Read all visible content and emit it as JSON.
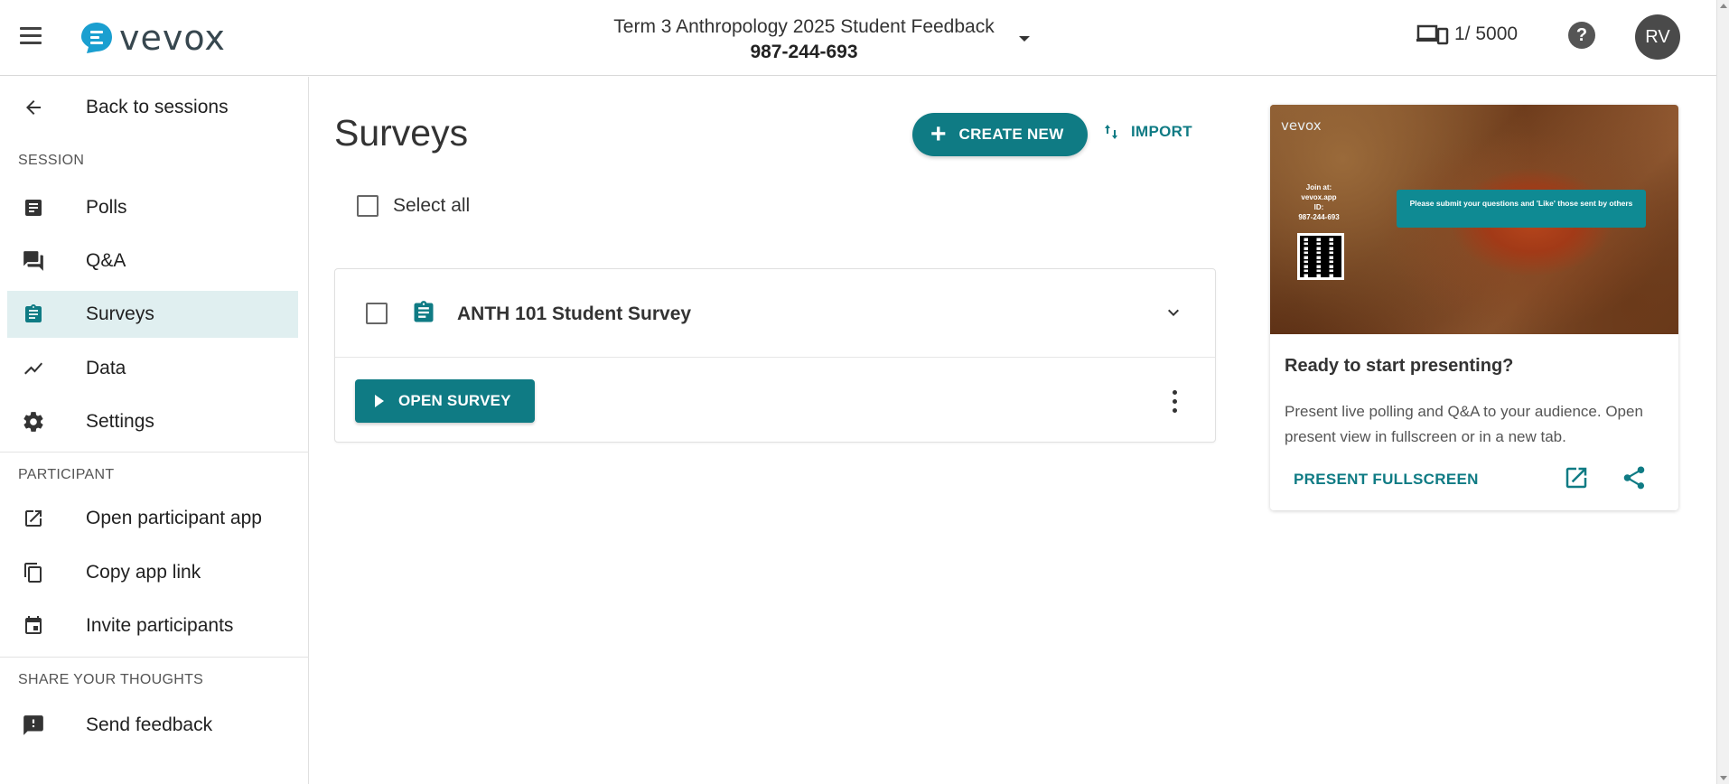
{
  "app": {
    "logo_text": "vevox",
    "brand_color": "#0f7b84"
  },
  "header": {
    "session_name": "Term 3 Anthropology 2025 Student Feedback",
    "session_id": "987-244-693",
    "participant_count": "1/ 5000",
    "help_icon_glyph": "?",
    "avatar_initials": "RV"
  },
  "sidebar": {
    "back_label": "Back to sessions",
    "session_section": "SESSION",
    "items": [
      {
        "label": "Polls",
        "icon": "polls-icon"
      },
      {
        "label": "Q&A",
        "icon": "qa-icon"
      },
      {
        "label": "Surveys",
        "icon": "surveys-icon",
        "active": true
      },
      {
        "label": "Data",
        "icon": "data-icon"
      },
      {
        "label": "Settings",
        "icon": "gear-icon"
      }
    ],
    "participant_section": "PARTICIPANT",
    "participant_items": [
      {
        "label": "Open participant app",
        "icon": "open-in-new-icon"
      },
      {
        "label": "Copy app link",
        "icon": "copy-icon"
      },
      {
        "label": "Invite participants",
        "icon": "calendar-icon"
      }
    ],
    "feedback_section": "SHARE YOUR THOUGHTS",
    "feedback_items": [
      {
        "label": "Send feedback",
        "icon": "feedback-icon"
      }
    ]
  },
  "main": {
    "title": "Surveys",
    "create_label": "CREATE NEW",
    "import_label": "IMPORT",
    "select_all_label": "Select all",
    "surveys": [
      {
        "title": "ANTH 101 Student Survey",
        "open_label": "OPEN SURVEY"
      }
    ]
  },
  "present": {
    "preview_logo": "vevox",
    "preview_join_lines": [
      "Join at:",
      "vevox.app",
      "ID:",
      "987-244-693"
    ],
    "preview_banner": "Please submit your questions and 'Like' those sent by others",
    "title": "Ready to start presenting?",
    "description": "Present live polling and Q&A to your audience. Open present view in fullscreen or in a new tab.",
    "fullscreen_label": "PRESENT FULLSCREEN"
  }
}
